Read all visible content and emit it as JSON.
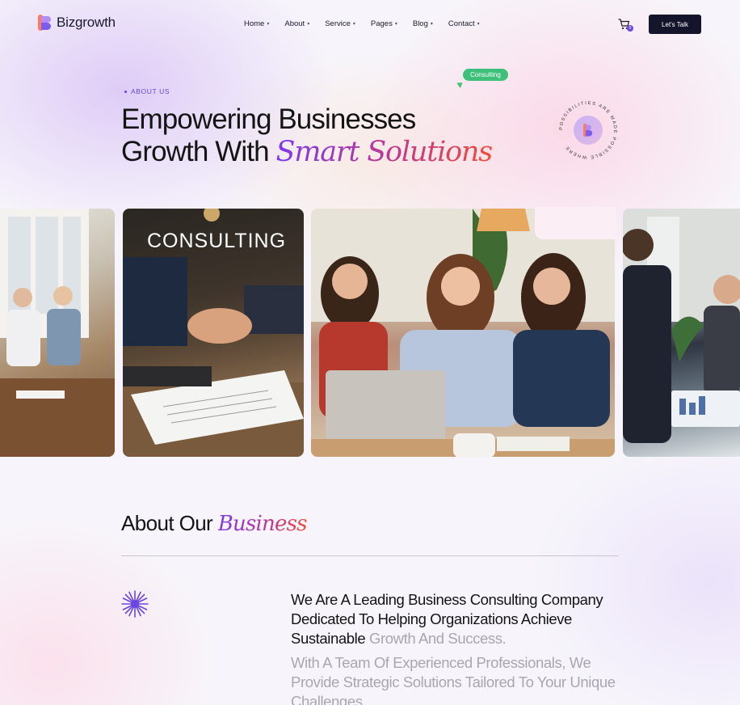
{
  "brand": {
    "name": "Bizgrowth"
  },
  "nav": {
    "items": [
      {
        "label": "Home"
      },
      {
        "label": "About"
      },
      {
        "label": "Service"
      },
      {
        "label": "Pages"
      },
      {
        "label": "Blog"
      },
      {
        "label": "Contact"
      }
    ],
    "cart_count": "0",
    "cta_label": "Let's Talk"
  },
  "hero": {
    "tag": "ABOUT US",
    "bubble": "Consulting",
    "title_line1": "Empowering Businesses",
    "title_line2_plain": "Growth With ",
    "title_line2_accent": "Smart Solutions",
    "badge_text": "POSSIBILITIES ARE MADE POSSIBLE WHERE"
  },
  "gallery": {
    "consulting_label": "CONSULTING"
  },
  "about": {
    "title_plain": "About Our ",
    "title_accent": "Business",
    "para1_dark": "We Are A Leading Business Consulting Company Dedicated To Helping Organizations Achieve Sustainable ",
    "para1_muted": "Growth And Success.",
    "para2": "With A Team Of Experienced Professionals, We Provide Strategic Solutions Tailored To Your Unique Challenges"
  },
  "colors": {
    "accent_purple": "#6b46e0",
    "cta_bg": "#14142b",
    "bubble_green": "#3ec07a",
    "logo_orange": "#ff7a59"
  }
}
